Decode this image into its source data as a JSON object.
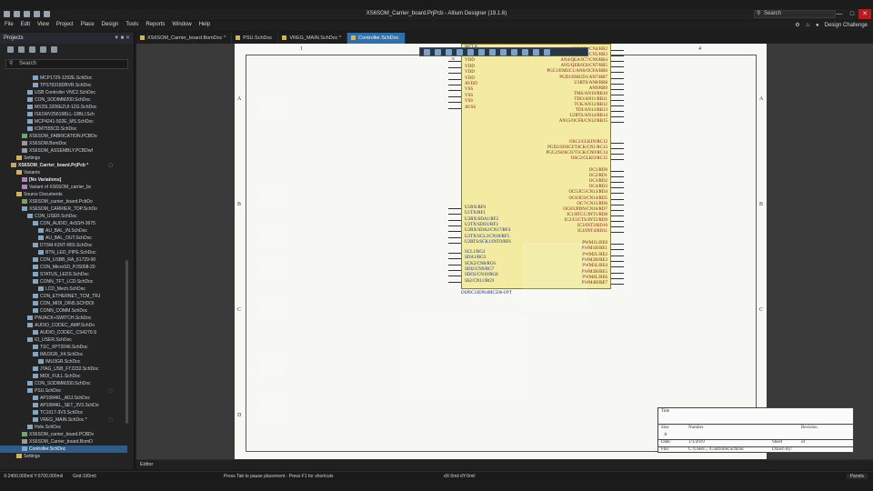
{
  "window": {
    "title": "XS6SOM_Carrier_board.PrjPcb - Altium Designer (19.1.6)",
    "search_placeholder": "Search"
  },
  "menu": [
    "File",
    "Edit",
    "View",
    "Project",
    "Place",
    "Design",
    "Tools",
    "Reports",
    "Window",
    "Help"
  ],
  "menu_right": {
    "account": "Design Challenge"
  },
  "projects_panel": {
    "title": "Projects",
    "search_placeholder": "Search",
    "tree": [
      {
        "label": "MCP1725-1202E.SchDoc",
        "indent": 6,
        "icon": "sch"
      },
      {
        "label": "TPS79318DBVR.SchDoc",
        "indent": 6,
        "icon": "sch"
      },
      {
        "label": "USB Controller VNC2.SchDoc",
        "indent": 5,
        "icon": "sch"
      },
      {
        "label": "CON_SODIMM200.SchDoc",
        "indent": 5,
        "icon": "sch"
      },
      {
        "label": "MX25L3206EZUI-12G.SchDoc",
        "indent": 5,
        "icon": "sch"
      },
      {
        "label": "IS61WV25616BLL-10BLI.Sch",
        "indent": 5,
        "icon": "sch"
      },
      {
        "label": "MCP4241-502E_MS.SchDoc",
        "indent": 5,
        "icon": "sch"
      },
      {
        "label": "ICM7555CD.SchDoc",
        "indent": 5,
        "icon": "sch"
      },
      {
        "label": "XS6SOM_FABRICATION.PCBDo",
        "indent": 4,
        "icon": "pcb"
      },
      {
        "label": "XS6SOM.BomDoc",
        "indent": 4,
        "icon": "doc"
      },
      {
        "label": "XS6SOM_ASSEMBLY.PCBDwf",
        "indent": 4,
        "icon": "doc"
      },
      {
        "label": "Settings",
        "indent": 3,
        "icon": "folder"
      },
      {
        "label": "XS6SOM_Carrier_board.PrjPcb *",
        "indent": 2,
        "icon": "proj",
        "bold": true,
        "badge": "▢"
      },
      {
        "label": "Variants",
        "indent": 3,
        "icon": "folder"
      },
      {
        "label": "[No Variations]",
        "indent": 4,
        "icon": "var",
        "bold": true
      },
      {
        "label": "Variant of XS6SOM_carrier_bc",
        "indent": 4,
        "icon": "var"
      },
      {
        "label": "Source Documents",
        "indent": 3,
        "icon": "folder"
      },
      {
        "label": "XS6SOM_carrier_board.PcbDo",
        "indent": 4,
        "icon": "pcb"
      },
      {
        "label": "XS6SOM_CARRIER_TOP.SchDo",
        "indent": 4,
        "icon": "sch"
      },
      {
        "label": "CON_USER.SchDoc",
        "indent": 5,
        "icon": "sch"
      },
      {
        "label": "CON_AUDIO_4xSSH-3675",
        "indent": 6,
        "icon": "sch"
      },
      {
        "label": "AU_BAL_IN.SchDoc",
        "indent": 7,
        "icon": "sch"
      },
      {
        "label": "AU_BAL_OUT.SchDoc",
        "indent": 7,
        "icon": "sch"
      },
      {
        "label": "DTSM-61NT-R65.SchDoc",
        "indent": 6,
        "icon": "sch"
      },
      {
        "label": "BTN_LED_PIPE.SchDoc",
        "indent": 7,
        "icon": "sch"
      },
      {
        "label": "CON_USBB_RA_61729-00",
        "indent": 6,
        "icon": "sch"
      },
      {
        "label": "CON_MicroSD_PJS008-20",
        "indent": 6,
        "icon": "sch"
      },
      {
        "label": "STATUS_LEDS.SchDoc",
        "indent": 6,
        "icon": "sch"
      },
      {
        "label": "CONN_TFT_LCD.SchDoc",
        "indent": 6,
        "icon": "sch"
      },
      {
        "label": "LCD_Mech.SchDoc",
        "indent": 7,
        "icon": "sch"
      },
      {
        "label": "CON_ETHERNET_TCM_TRJ",
        "indent": 6,
        "icon": "sch"
      },
      {
        "label": "CON_MIDI_DIN5.SCHDOI",
        "indent": 6,
        "icon": "sch"
      },
      {
        "label": "CONN_COMM.SchDoc",
        "indent": 6,
        "icon": "sch"
      },
      {
        "label": "PWJACK+SWITCH.SchDoc",
        "indent": 5,
        "icon": "sch"
      },
      {
        "label": "AUDIO_CODEC_AMP.SchDo",
        "indent": 5,
        "icon": "sch"
      },
      {
        "label": "AUDIO_CODEC_CS4270.S",
        "indent": 6,
        "icon": "sch"
      },
      {
        "label": "IO_USER.SchDoc",
        "indent": 5,
        "icon": "sch"
      },
      {
        "label": "TSC_XPT2046.SchDoc",
        "indent": 6,
        "icon": "sch"
      },
      {
        "label": "IMU3GR_X4.SchDoc",
        "indent": 6,
        "icon": "sch"
      },
      {
        "label": "IMU3GR.SchDoc",
        "indent": 7,
        "icon": "sch"
      },
      {
        "label": "JTAG_USB_FT2232.SchDoc",
        "indent": 6,
        "icon": "sch"
      },
      {
        "label": "MIDI_FULL.SchDoc",
        "indent": 6,
        "icon": "sch"
      },
      {
        "label": "CON_SODIMM200.SchDoc",
        "indent": 5,
        "icon": "sch"
      },
      {
        "label": "PSU.SchDoc",
        "indent": 5,
        "icon": "sch",
        "badge": "▢"
      },
      {
        "label": "AP1084KL_ADJ.SchDoc",
        "indent": 6,
        "icon": "sch"
      },
      {
        "label": "AP1084KL_SET_3V3.SchDo",
        "indent": 6,
        "icon": "sch"
      },
      {
        "label": "TC1017-3V3.SchDoc",
        "indent": 6,
        "icon": "sch"
      },
      {
        "label": "VREG_MAIN.SchDoc *",
        "indent": 6,
        "icon": "sch",
        "badge": "▢"
      },
      {
        "label": "Hole.SchDoc",
        "indent": 5,
        "icon": "sch"
      },
      {
        "label": "XS6SOM_carrier_board.PCBDv",
        "indent": 4,
        "icon": "pcb"
      },
      {
        "label": "XS6SOM_Carrier_board.BomD",
        "indent": 4,
        "icon": "doc"
      },
      {
        "label": "Controller.SchDoc",
        "indent": 4,
        "icon": "sch",
        "selected": true
      },
      {
        "label": "Settings",
        "indent": 3,
        "icon": "folder"
      }
    ]
  },
  "doc_tabs": [
    {
      "label": "XS6SOM_Carrier_board.BomDoc *",
      "active": false
    },
    {
      "label": "PSU.SchDoc",
      "active": false
    },
    {
      "label": "VREG_MAIN.SchDoc *",
      "active": false
    },
    {
      "label": "Controller.SchDoc",
      "active": true
    }
  ],
  "sheet": {
    "col_labels": [
      "1",
      "2",
      "3",
      "4"
    ],
    "row_labels": [
      "A",
      "B",
      "C",
      "D"
    ],
    "component": {
      "designator": "DSPIC33EP64MC506-I/PT",
      "top_label": "MCLR",
      "left_pins": [
        {
          "num": "",
          "name": "VCAP/VDDCORE"
        },
        {
          "num": "10",
          "name": "VDD"
        },
        {
          "num": "",
          "name": "VDD"
        },
        {
          "num": "",
          "name": "VDD"
        },
        {
          "num": "",
          "name": "VDD"
        },
        {
          "num": "",
          "name": "AVDD"
        },
        {
          "num": "",
          "name": "VSS"
        },
        {
          "num": "",
          "name": "VSS"
        },
        {
          "num": "",
          "name": "VSS"
        },
        {
          "num": "",
          "name": "AVSS"
        },
        {
          "num": "",
          "name": "U1RX/RF0"
        },
        {
          "num": "",
          "name": "U1TX/RF1"
        },
        {
          "num": "",
          "name": "U2RX/SDA1/RF2"
        },
        {
          "num": "",
          "name": "U2TX/SDO1/RF3"
        },
        {
          "num": "",
          "name": "U2RX/SDA2/CN17/RF4"
        },
        {
          "num": "",
          "name": "U2TX/SCL2/CN18/RF5"
        },
        {
          "num": "",
          "name": "U2RTS/SCK1/INT0/RF6"
        },
        {
          "num": "",
          "name": "SCL1/RG2"
        },
        {
          "num": "",
          "name": "SDA1/RG3"
        },
        {
          "num": "",
          "name": "SCK2/CN8/RG6"
        },
        {
          "num": "",
          "name": "SDI2/CN9/RG7"
        },
        {
          "num": "",
          "name": "SDO2/CN10/RG8"
        },
        {
          "num": "",
          "name": "SS2/CN11/RG9"
        }
      ],
      "right_pins": [
        {
          "name": "AN2/SS1/CN4/RB2"
        },
        {
          "name": "AN3/INDX/CN5/RB3"
        },
        {
          "name": "AN4/QEA/IC7/CN6/RB4"
        },
        {
          "name": "AN5/QEB/IC8/CN7/RB5"
        },
        {
          "name": "PGC1/EMUC1/AN6/OCFA/RB6"
        },
        {
          "name": "PGD1/EMUD1/AN7/RB7"
        },
        {
          "name": "U1RTS/AN8/RB8"
        },
        {
          "name": "AN9/RB9"
        },
        {
          "name": "TMS/AN10/RB10"
        },
        {
          "name": "TDO/AN11/RB11"
        },
        {
          "name": "TCK/AN12/RB12"
        },
        {
          "name": "TDI/AN13/RB13"
        },
        {
          "name": "U2RTS/AN14/RB14"
        },
        {
          "name": "AN15/OCFB/CN12/RB15"
        },
        {
          "name": "OSC1/CLKIN/RC12"
        },
        {
          "name": "PGD2/SOSCI/T4CK/CN1/RC13"
        },
        {
          "name": "PGC2/SOSCO/T1CK/CN0/RC14"
        },
        {
          "name": "OSC2/CLKO/RC15"
        },
        {
          "name": "OC1/RD0"
        },
        {
          "name": "OC2/RD1"
        },
        {
          "name": "OC3/RD2"
        },
        {
          "name": "OC4/RD3"
        },
        {
          "name": "OC5/IC5/CN13/RD4"
        },
        {
          "name": "OC6/IC6/CN14/RD5"
        },
        {
          "name": "OC7/CN15/RD6"
        },
        {
          "name": "OC8/UPDN/CN16/RD7"
        },
        {
          "name": "IC1/RTCC/INT1/RD8"
        },
        {
          "name": "IC2/U1CTS/INT2/RD9"
        },
        {
          "name": "IC3/INT3/RD10"
        },
        {
          "name": "IC4/INT4/RD11"
        },
        {
          "name": "PWM1L/RE0"
        },
        {
          "name": "PWM1H/RE1"
        },
        {
          "name": "PWM2L/RE2"
        },
        {
          "name": "PWM2H/RE3"
        },
        {
          "name": "PWM3L/RE4"
        },
        {
          "name": "PWM3H/RE5"
        },
        {
          "name": "PWM4L/RE6"
        },
        {
          "name": "PWM4H/RE7"
        }
      ]
    },
    "title_block": {
      "title_label": "Title",
      "size_label": "Size",
      "size_value": "A",
      "number_label": "Number",
      "revision_label": "Revision",
      "date_label": "Date:",
      "date_value": "1/1/2019",
      "sheet_label": "Sheet",
      "of_label": "of",
      "file_label": "File:",
      "file_value": "C:\\Users\\...\\Controller.SchDoc",
      "drawn_label": "Drawn By:"
    }
  },
  "editor_tab": "Editor",
  "status": {
    "coords": "X:2400.000mil Y:5700.000mil",
    "grid": "Grid:100mil",
    "hint": "Press Tab to pause placement - Press F1 for shortcuts",
    "delta": "dX:0mil dY:0mil",
    "panels": "Panels"
  },
  "colors": {
    "sheet_bg": "#f7f7f4",
    "component_fill": "#f2eba1",
    "pin_text": "#7a1a1a",
    "active_tab": "#2f6fae",
    "selected_tree": "#2f5d8a"
  }
}
